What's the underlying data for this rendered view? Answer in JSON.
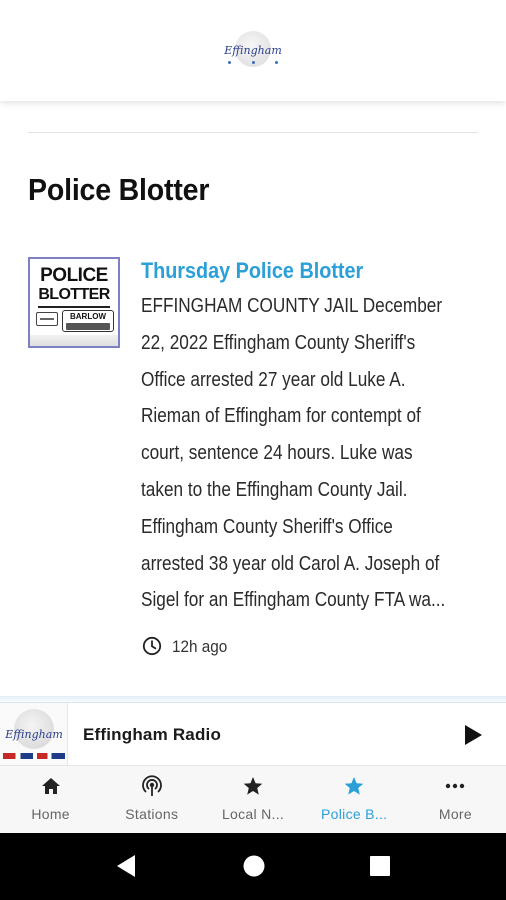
{
  "header": {
    "logo_text": "Effingham"
  },
  "page": {
    "title": "Police Blotter"
  },
  "article": {
    "thumbnail": {
      "line1": "POLICE",
      "line2": "BLOTTER",
      "sponsor": "BARLOW"
    },
    "title": "Thursday Police Blotter",
    "body_lines": [
      "EFFINGHAM COUNTY JAIL December",
      "22, 2022 Effingham County Sheriff's",
      "Office arrested 27 year old Luke A.",
      "Rieman of Effingham for contempt of",
      "court, sentence 24 hours. Luke was",
      "taken to the Effingham County Jail.",
      "Effingham County Sheriff's Office",
      "arrested 38 year old Carol A. Joseph of",
      "Sigel for an Effingham County FTA wa..."
    ],
    "time_ago": "12h ago"
  },
  "player": {
    "art_text": "Effingham",
    "title": "Effingham Radio",
    "play_icon": "play-icon"
  },
  "tabs": [
    {
      "label": "Home",
      "icon": "home-icon"
    },
    {
      "label": "Stations",
      "icon": "broadcast-icon"
    },
    {
      "label": "Local N...",
      "icon": "star-icon"
    },
    {
      "label": "Police B...",
      "icon": "star-icon",
      "active": true
    },
    {
      "label": "More",
      "icon": "more-dots-icon"
    }
  ],
  "colors": {
    "accent": "#2a9fd8",
    "text": "#2a2a2a",
    "tab_inactive": "#666666",
    "system_nav": "#000000"
  }
}
